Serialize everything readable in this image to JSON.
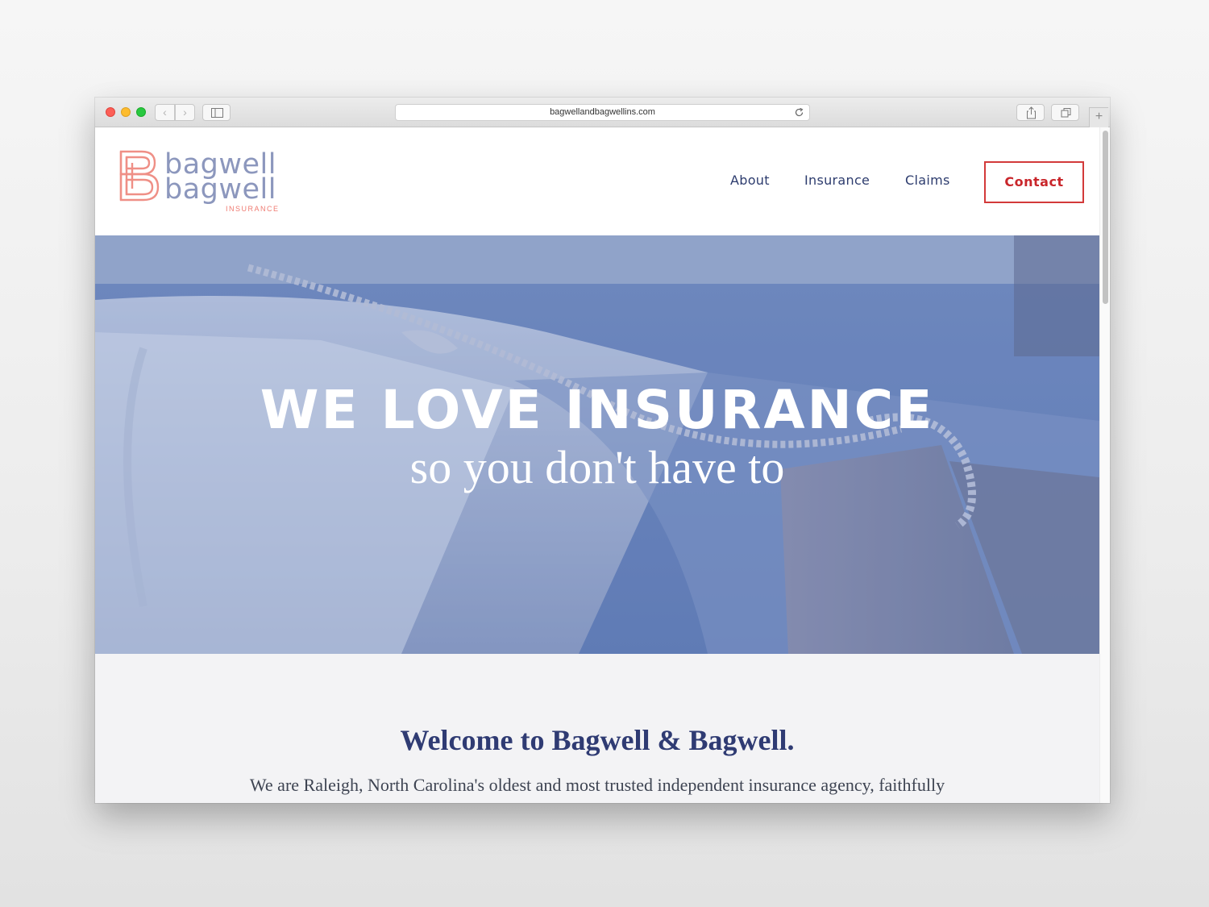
{
  "browser": {
    "url": "bagwellandbagwellins.com",
    "new_tab_symbol": "+",
    "back_symbol": "‹",
    "forward_symbol": "›"
  },
  "header": {
    "logo": {
      "line1": "bagwell",
      "line2": "bagwell",
      "tagline": "INSURANCE"
    },
    "nav": {
      "about": "About",
      "insurance": "Insurance",
      "claims": "Claims",
      "contact": "Contact"
    }
  },
  "hero": {
    "title": "WE LOVE INSURANCE",
    "subtitle": "so you don't have to"
  },
  "welcome": {
    "title": "Welcome to Bagwell & Bagwell.",
    "body": "We are Raleigh, North Carolina's oldest and most trusted independent insurance agency, faithfully"
  },
  "colors": {
    "brand_navy": "#2d3c6e",
    "brand_coral": "#ef7b72",
    "contact_red": "#c9262b",
    "logo_blue": "#8c97bd"
  }
}
